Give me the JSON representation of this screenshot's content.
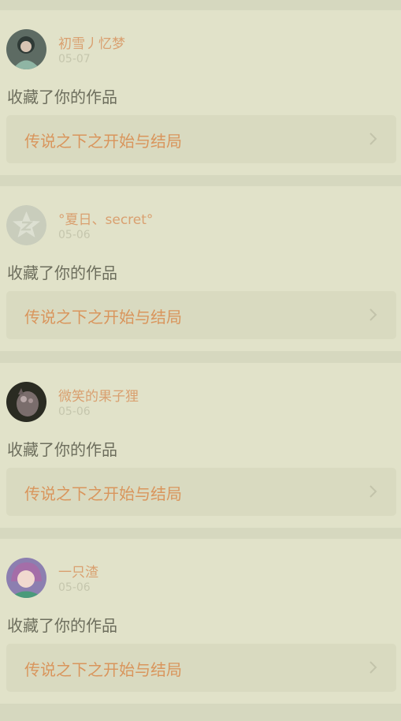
{
  "colors": {
    "page_bg": "#d6d8bf",
    "card_bg": "#e1e2c9",
    "work_bg": "#d9dac0",
    "name": "#d9a070",
    "date": "#c5c6ad",
    "action": "#6d6e5d",
    "work_title": "#d9955c"
  },
  "items": [
    {
      "user": "初雪丿忆梦",
      "date": "05-07",
      "action": "收藏了你的作品",
      "work": "传说之下之开始与结局",
      "avatar": "user-avatar-photo"
    },
    {
      "user": "°夏日、secret°",
      "date": "05-06",
      "action": "收藏了你的作品",
      "work": "传说之下之开始与结局",
      "avatar": "default-avatar-icon"
    },
    {
      "user": "微笑的果子狸",
      "date": "05-06",
      "action": "收藏了你的作品",
      "work": "传说之下之开始与结局",
      "avatar": "user-avatar-photo"
    },
    {
      "user": "一只渣",
      "date": "05-06",
      "action": "收藏了你的作品",
      "work": "传说之下之开始与结局",
      "avatar": "user-avatar-photo"
    }
  ]
}
